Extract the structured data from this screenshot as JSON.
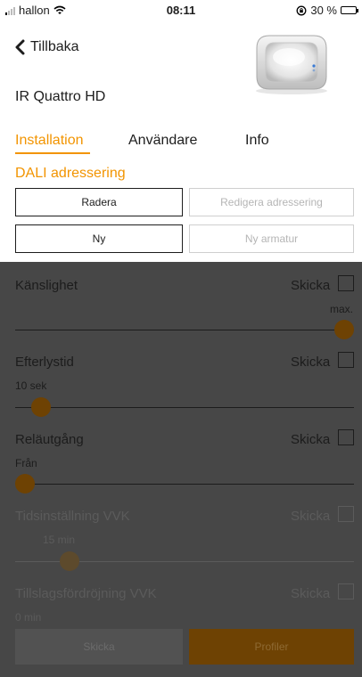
{
  "status_bar": {
    "carrier": "hallon",
    "time": "08:11",
    "battery_text": "30 %",
    "battery_level": 0.3
  },
  "header": {
    "back_label": "Tillbaka",
    "device_name": "IR Quattro HD"
  },
  "tabs": [
    {
      "label": "Installation",
      "active": true
    },
    {
      "label": "Användare",
      "active": false
    },
    {
      "label": "Info",
      "active": false
    }
  ],
  "dali": {
    "title": "DALI adressering",
    "buttons": {
      "radera": "Radera",
      "redigera": "Redigera adressering",
      "ny": "Ny",
      "ny_armatur": "Ny armatur"
    }
  },
  "settings": [
    {
      "label": "Känslighet",
      "send_label": "Skicka",
      "value_text": "max.",
      "slider_fraction": 1.0
    },
    {
      "label": "Efterlystid",
      "send_label": "Skicka",
      "value_text": "10 sek",
      "slider_fraction": 0.05
    },
    {
      "label": "Reläutgång",
      "send_label": "Skicka",
      "value_text": "Från",
      "slider_fraction": 0.0
    },
    {
      "label": "Tidsinställning VVK",
      "send_label": "Skicka",
      "value_text": "15 min",
      "slider_fraction": 0.14
    },
    {
      "label": "Tillslagsfördröjning VVK",
      "send_label": "Skicka",
      "value_text": "0 min"
    }
  ],
  "footer": {
    "send_label": "Skicka",
    "profiles_label": "Profiler"
  },
  "colors": {
    "accent": "#f29400",
    "overlay": "#474747"
  }
}
